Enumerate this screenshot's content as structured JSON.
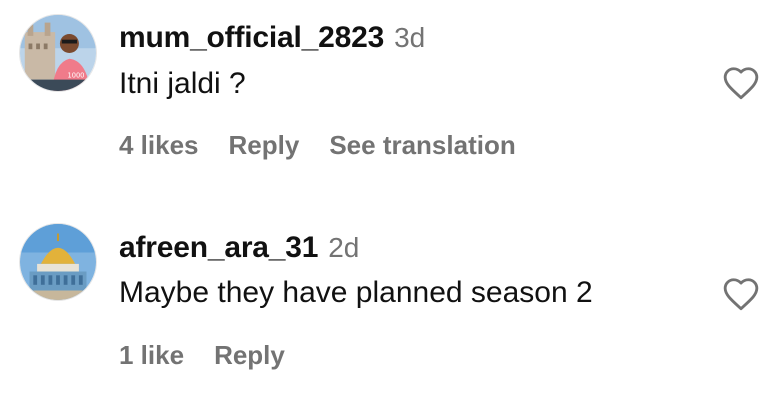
{
  "comments": [
    {
      "username": "mum_official_2823",
      "time": "3d",
      "text": "Itni jaldi ?",
      "likes": "4 likes",
      "reply": "Reply",
      "translate": "See translation",
      "avatar_icon": "avatar-photo-icon"
    },
    {
      "username": "afreen_ara_31",
      "time": "2d",
      "text": "Maybe they have planned season 2",
      "likes": "1 like",
      "reply": "Reply",
      "avatar_icon": "avatar-photo-icon"
    }
  ],
  "icons": {
    "like": "heart-outline-icon"
  },
  "colors": {
    "primary_text": "#111111",
    "secondary_text": "#737373",
    "background": "#ffffff"
  }
}
